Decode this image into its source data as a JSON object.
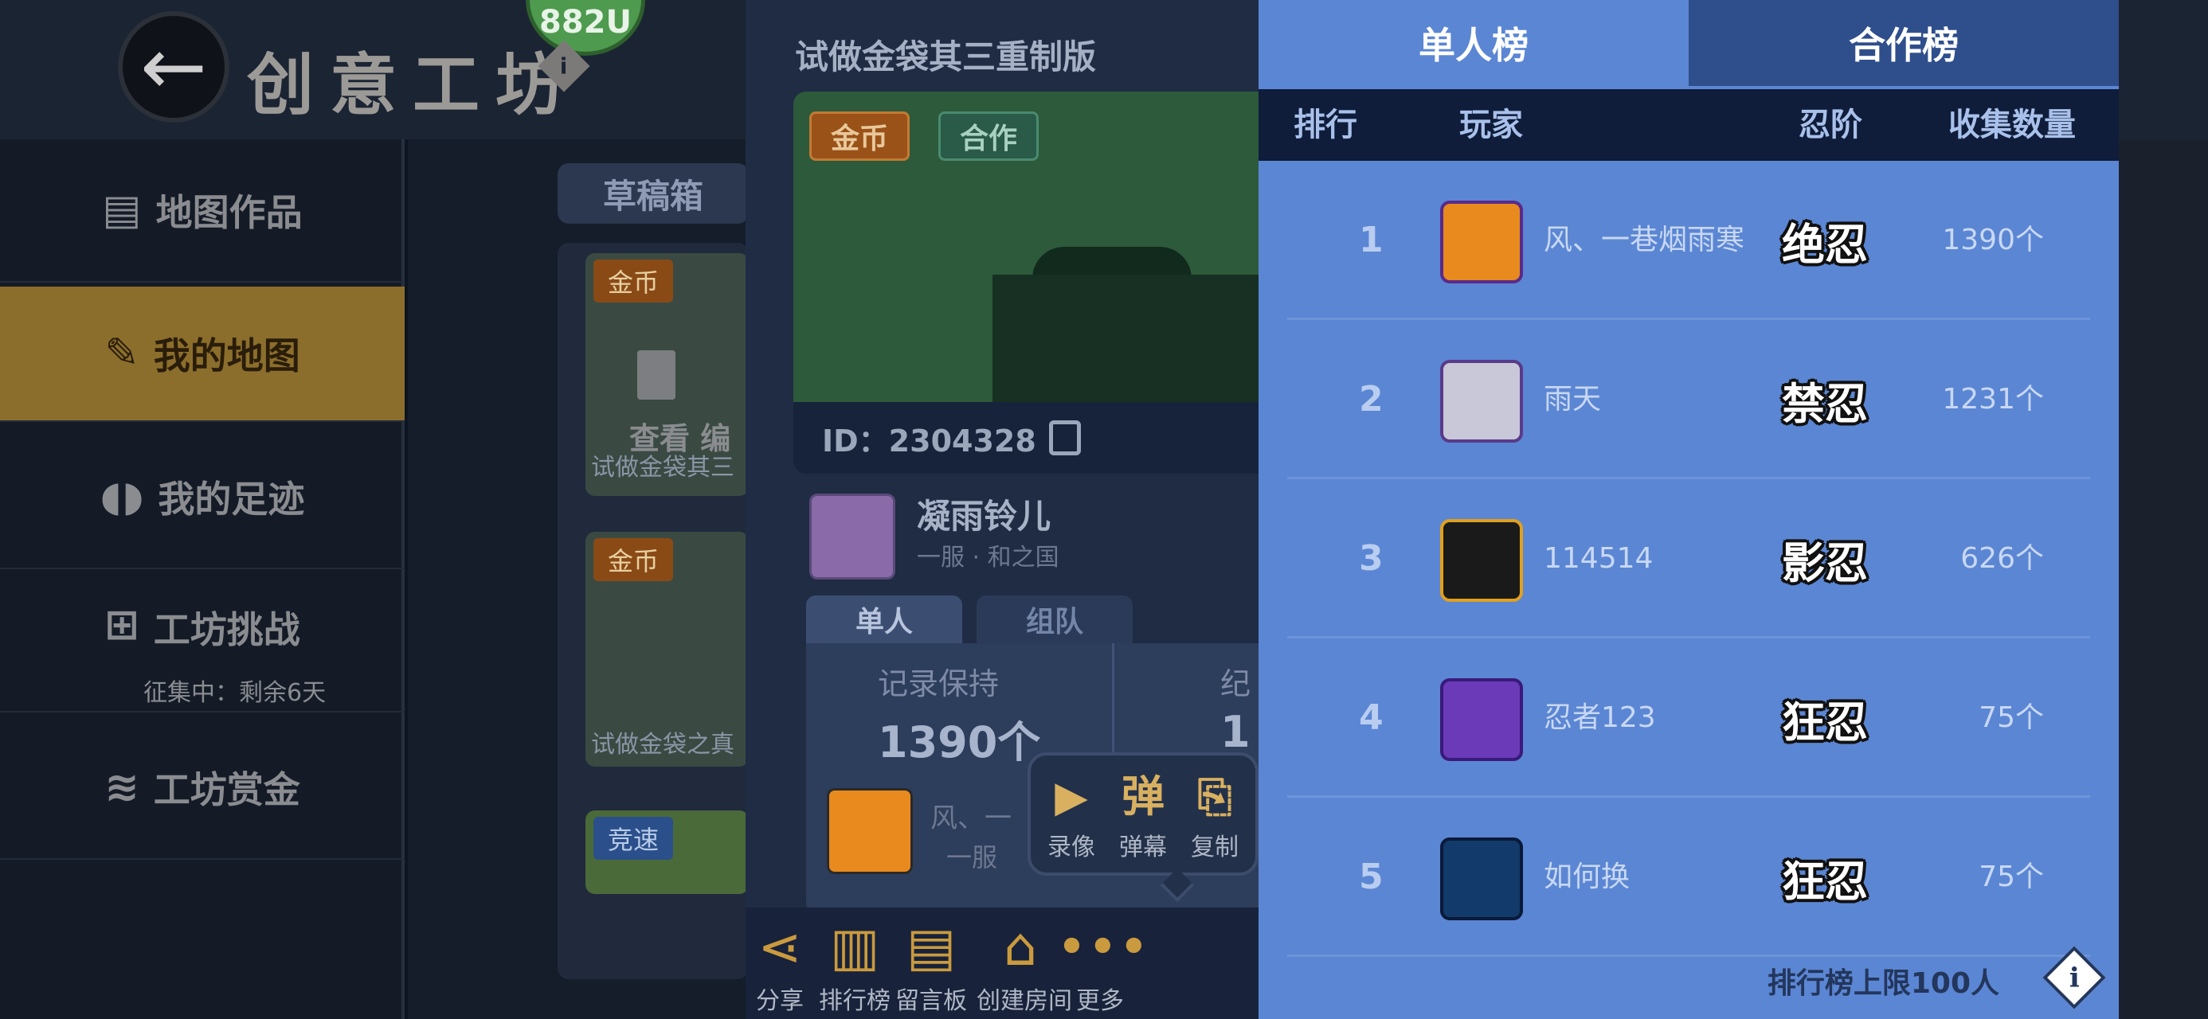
{
  "app": {
    "title": "创意工坊",
    "badge": "882U",
    "info_icon": "i"
  },
  "sidebar": {
    "items": [
      {
        "icon": "map-icon",
        "label": "地图作品"
      },
      {
        "icon": "pencil-icon",
        "label": "我的地图"
      },
      {
        "icon": "footprints-icon",
        "label": "我的足迹"
      },
      {
        "icon": "gamepad-icon",
        "label": "工坊挑战",
        "sub": "征集中：剩余6天"
      },
      {
        "icon": "coins-icon",
        "label": "工坊赏金"
      }
    ]
  },
  "drafts": {
    "tab": "草稿箱",
    "cards": [
      {
        "tag": "金币",
        "view": "查看",
        "edit": "编",
        "caption": "试做金袋其三"
      },
      {
        "tag": "金币",
        "caption": "试做金袋之真"
      },
      {
        "tag": "竞速"
      }
    ]
  },
  "detail": {
    "title": "试做金袋其三重制版",
    "tags": [
      "金币",
      "合作"
    ],
    "id_label": "ID：2304328",
    "author": {
      "name": "凝雨铃儿",
      "sub": "一服 · 和之国"
    },
    "mode_tabs": [
      "单人",
      "组队"
    ],
    "record": {
      "label": "记录保持",
      "value": "1390个",
      "partial_label": "纪",
      "partial_value": "1"
    },
    "record_holder": {
      "name": "风、一",
      "sub": "一服"
    },
    "more_menu": [
      {
        "icon": "video-icon",
        "label": "录像"
      },
      {
        "icon": "danmaku-icon",
        "label": "弹幕",
        "glyph": "弹"
      },
      {
        "icon": "copy-icon",
        "label": "复制"
      }
    ],
    "toolbar": [
      {
        "icon": "share-icon",
        "label": "分享"
      },
      {
        "icon": "ranking-icon",
        "label": "排行榜"
      },
      {
        "icon": "message-board-icon",
        "label": "留言板"
      },
      {
        "icon": "home-icon",
        "label": "创建房间"
      },
      {
        "icon": "more-icon",
        "label": "更多"
      }
    ]
  },
  "leaderboard": {
    "tabs": [
      "单人榜",
      "合作榜"
    ],
    "columns": [
      "排行",
      "玩家",
      "忍阶",
      "收集数量"
    ],
    "rows": [
      {
        "rank": "1",
        "player": "风、一巷烟雨寒",
        "tier": "绝忍",
        "count": "1390个"
      },
      {
        "rank": "2",
        "player": "雨天",
        "tier": "禁忍",
        "count": "1231个"
      },
      {
        "rank": "3",
        "player": "114514",
        "tier": "影忍",
        "count": "626个"
      },
      {
        "rank": "4",
        "player": "忍者123",
        "tier": "狂忍",
        "count": "75个"
      },
      {
        "rank": "5",
        "player": "如何换",
        "tier": "狂忍",
        "count": "75个"
      }
    ],
    "footer": "排行榜上限100人",
    "footer_icon": "i"
  },
  "colors": {
    "panel_blue": "#5b86d3",
    "tab_inactive": "#2f4e8c",
    "header_dark": "#0f1d3b",
    "accent_gold": "#8c6e2c"
  }
}
